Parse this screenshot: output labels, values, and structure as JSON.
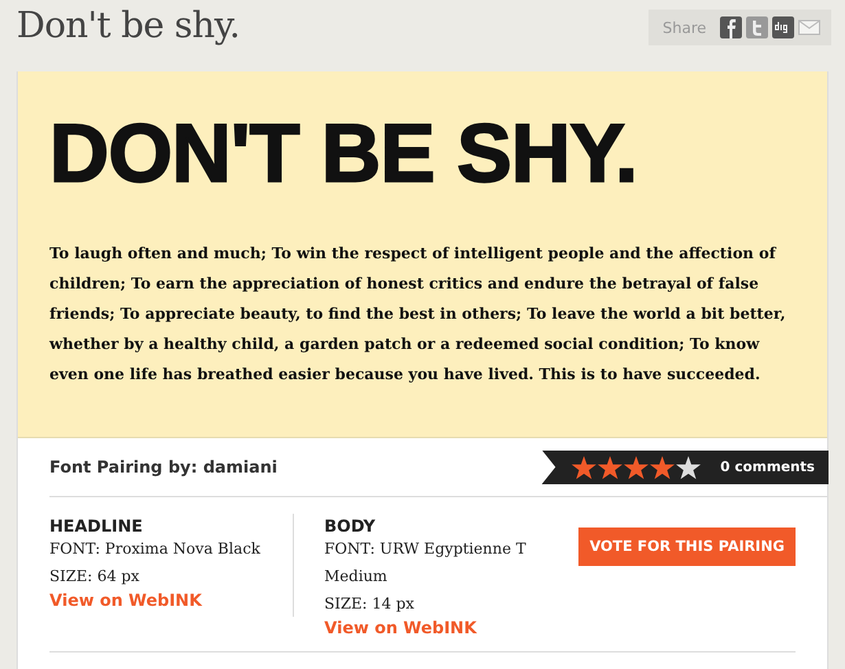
{
  "page_title": "Don't be shy.",
  "share": {
    "label": "Share",
    "icons": [
      {
        "kind": "facebook"
      },
      {
        "kind": "twitter"
      },
      {
        "kind": "digg"
      },
      {
        "kind": "mail"
      }
    ]
  },
  "sample": {
    "headline": "DON'T BE SHY.",
    "body": "To laugh often and much; To win the respect of intelligent people and the affection of children; To earn the appreciation of honest critics and endure the betrayal of false friends; To appreciate beauty, to find the best in others; To leave the world a bit better, whether by a healthy child, a garden patch or a redeemed social condition; To know even one life has breathed easier because you have lived. This is to have succeeded."
  },
  "byline": "Font Pairing by: damiani",
  "rating": {
    "stars": 4,
    "comments": "0 comments"
  },
  "columns": [
    {
      "heading": "HEADLINE",
      "lines": [
        "FONT: Proxima Nova Black",
        "SIZE: 64 px"
      ],
      "link": "View on WebINK"
    },
    {
      "heading": "BODY",
      "lines": [
        "FONT: URW Egyptienne T Medium",
        "SIZE: 14 px"
      ],
      "link": "View on WebINK"
    }
  ],
  "vote_button": "VOTE FOR THIS PAIRING"
}
